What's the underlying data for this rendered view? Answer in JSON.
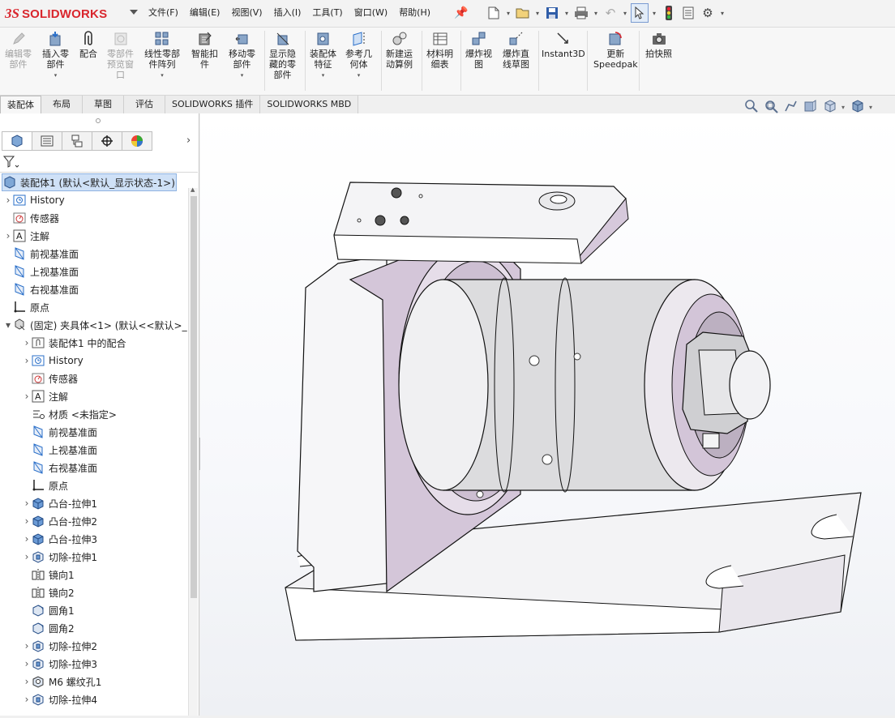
{
  "app": {
    "logo_ds": "3S",
    "logo_name": "SOLIDWORKS"
  },
  "menus": [
    "文件(F)",
    "编辑(E)",
    "视图(V)",
    "插入(I)",
    "工具(T)",
    "窗口(W)",
    "帮助(H)"
  ],
  "ribbon": {
    "buttons": [
      {
        "label": "编辑零\n部件",
        "enabled": false
      },
      {
        "label": "插入零\n部件",
        "enabled": true
      },
      {
        "label": "配合",
        "enabled": true
      },
      {
        "label": "零部件\n预览窗\n口",
        "enabled": false
      },
      {
        "label": "线性零部\n件阵列",
        "enabled": true
      },
      {
        "label": "智能扣\n件",
        "enabled": true
      },
      {
        "label": "移动零\n部件",
        "enabled": true
      },
      {
        "label": "显示隐\n藏的零\n部件",
        "enabled": true
      },
      {
        "label": "装配体\n特征",
        "enabled": true
      },
      {
        "label": "参考几\n何体",
        "enabled": true
      },
      {
        "label": "新建运\n动算例",
        "enabled": true
      },
      {
        "label": "材料明\n细表",
        "enabled": true
      },
      {
        "label": "爆炸视\n图",
        "enabled": true
      },
      {
        "label": "爆炸直\n线草图",
        "enabled": true
      },
      {
        "label": "Instant3D",
        "enabled": true
      },
      {
        "label": "更新\nSpeedpak",
        "enabled": true
      },
      {
        "label": "拍快照",
        "enabled": true
      }
    ]
  },
  "command_tabs": [
    "装配体",
    "布局",
    "草图",
    "评估",
    "SOLIDWORKS 插件",
    "SOLIDWORKS MBD"
  ],
  "feature_tree": {
    "root": "装配体1  (默认<默认_显示状态-1>)",
    "items": [
      {
        "label": "History",
        "icon": "history-icon",
        "indent": 0,
        "expandable": true
      },
      {
        "label": "传感器",
        "icon": "sensor-icon",
        "indent": 0,
        "expandable": false
      },
      {
        "label": "注解",
        "icon": "annotation-icon",
        "indent": 0,
        "expandable": true
      },
      {
        "label": "前视基准面",
        "icon": "plane-icon",
        "indent": 0,
        "expandable": false
      },
      {
        "label": "上视基准面",
        "icon": "plane-icon",
        "indent": 0,
        "expandable": false
      },
      {
        "label": "右视基准面",
        "icon": "plane-icon",
        "indent": 0,
        "expandable": false
      },
      {
        "label": "原点",
        "icon": "origin-icon",
        "indent": 0,
        "expandable": false
      },
      {
        "label": "(固定) 夹具体<1> (默认<<默认>_",
        "icon": "part-icon",
        "indent": 0,
        "expandable": true,
        "expanded": true
      },
      {
        "label": "装配体1 中的配合",
        "icon": "mate-icon",
        "indent": 1,
        "expandable": true
      },
      {
        "label": "History",
        "icon": "history-icon",
        "indent": 1,
        "expandable": true
      },
      {
        "label": "传感器",
        "icon": "sensor-icon",
        "indent": 1,
        "expandable": false
      },
      {
        "label": "注解",
        "icon": "annotation-icon",
        "indent": 1,
        "expandable": true
      },
      {
        "label": "材质 <未指定>",
        "icon": "material-icon",
        "indent": 1,
        "expandable": false
      },
      {
        "label": "前视基准面",
        "icon": "plane-icon",
        "indent": 1,
        "expandable": false
      },
      {
        "label": "上视基准面",
        "icon": "plane-icon",
        "indent": 1,
        "expandable": false
      },
      {
        "label": "右视基准面",
        "icon": "plane-icon",
        "indent": 1,
        "expandable": false
      },
      {
        "label": "原点",
        "icon": "origin-icon",
        "indent": 1,
        "expandable": false
      },
      {
        "label": "凸台-拉伸1",
        "icon": "boss-extrude-icon",
        "indent": 1,
        "expandable": true
      },
      {
        "label": "凸台-拉伸2",
        "icon": "boss-extrude-icon",
        "indent": 1,
        "expandable": true
      },
      {
        "label": "凸台-拉伸3",
        "icon": "boss-extrude-icon",
        "indent": 1,
        "expandable": true
      },
      {
        "label": "切除-拉伸1",
        "icon": "cut-extrude-icon",
        "indent": 1,
        "expandable": true
      },
      {
        "label": "镜向1",
        "icon": "mirror-icon",
        "indent": 1,
        "expandable": false
      },
      {
        "label": "镜向2",
        "icon": "mirror-icon",
        "indent": 1,
        "expandable": false
      },
      {
        "label": "圆角1",
        "icon": "fillet-icon",
        "indent": 1,
        "expandable": false
      },
      {
        "label": "圆角2",
        "icon": "fillet-icon",
        "indent": 1,
        "expandable": false
      },
      {
        "label": "切除-拉伸2",
        "icon": "cut-extrude-icon",
        "indent": 1,
        "expandable": true
      },
      {
        "label": "切除-拉伸3",
        "icon": "cut-extrude-icon",
        "indent": 1,
        "expandable": true
      },
      {
        "label": "M6 螺纹孔1",
        "icon": "hole-wizard-icon",
        "indent": 1,
        "expandable": true
      },
      {
        "label": "切除-拉伸4",
        "icon": "cut-extrude-icon",
        "indent": 1,
        "expandable": true
      }
    ]
  },
  "colors": {
    "accent": "#2a6fc9",
    "brand": "#d9262d",
    "model_face": "#f4f4f6",
    "model_side": "#d5c8d8",
    "model_shadow": "#b8a8bc"
  }
}
